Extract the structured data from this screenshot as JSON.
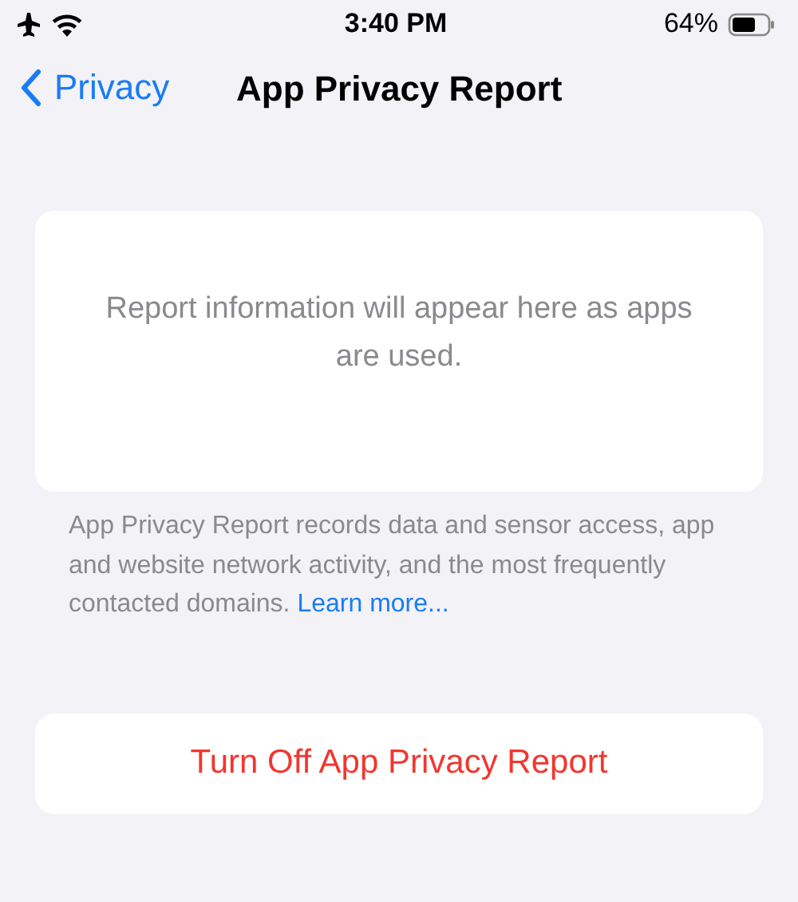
{
  "status_bar": {
    "time": "3:40 PM",
    "battery": "64%"
  },
  "nav": {
    "back": "Privacy",
    "title": "App Privacy Report"
  },
  "report_card": {
    "message": "Report information will appear here as apps are used."
  },
  "footer": {
    "text": "App Privacy Report records data and sensor access, app and website network activity, and the most frequently contacted domains.",
    "link": "Learn more..."
  },
  "action": {
    "label": "Turn Off App Privacy Report"
  }
}
